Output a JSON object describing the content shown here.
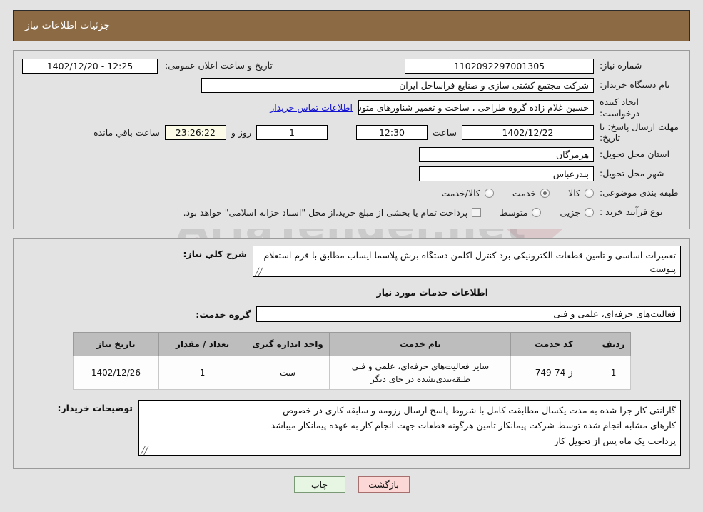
{
  "header": {
    "title": "جزئیات اطلاعات نیاز"
  },
  "form": {
    "need_number_label": "شماره نیاز:",
    "need_number_value": "1102092297001305",
    "announce_label": "تاریخ و ساعت اعلان عمومی:",
    "announce_value": "12:25 - 1402/12/20",
    "buyer_label": "نام دستگاه خریدار:",
    "buyer_value": "شرکت مجتمع کشتی سازی و صنایع فراساحل ایران",
    "creator_label": "ایجاد کننده درخواست:",
    "creator_value": "حسین  غلام زاده گروه طراحی ، ساخت و تعمیر شناورهای متوسط شرکت مجتد",
    "contact_link": "اطلاعات تماس خریدار",
    "deadline_label": "مهلت ارسال پاسخ: تا تاریخ:",
    "deadline_date": "1402/12/22",
    "hour_word": "ساعت",
    "deadline_time": "12:30",
    "days_value": "1",
    "days_word": "روز و",
    "timer_value": "23:26:22",
    "remaining_word": "ساعت باقي مانده",
    "province_label": "استان محل تحویل:",
    "province_value": "هرمزگان",
    "city_label": "شهر محل تحویل:",
    "city_value": "بندرعباس",
    "category_label": "طبقه بندی موضوعی:",
    "category_options": [
      {
        "label": "کالا",
        "selected": false
      },
      {
        "label": "خدمت",
        "selected": true
      },
      {
        "label": "کالا/خدمت",
        "selected": false
      }
    ],
    "process_label": "نوع فرآیند خرید :",
    "process_options": [
      {
        "label": "جزیی",
        "selected": false
      },
      {
        "label": "متوسط",
        "selected": false
      }
    ],
    "treasury_note": "پرداخت تمام یا بخشی از مبلغ خرید،از محل \"اسناد خزانه اسلامی\" خواهد بود."
  },
  "description": {
    "label": "شرح کلي نیاز:",
    "value": "تعمیرات اساسی و تامین قطعات الکترونیکی برد کنترل اکلمن دستگاه برش پلاسما ایساب مطابق با فرم استعلام پیوست"
  },
  "services": {
    "section_title": "اطلاعات خدمات مورد نیاز",
    "group_label": "گروه خدمت:",
    "group_value": "فعالیت‌های حرفه‌ای، علمی و فنی",
    "columns": [
      "ردیف",
      "کد خدمت",
      "نام خدمت",
      "واحد اندازه گیری",
      "تعداد / مقدار",
      "تاریخ نیاز"
    ],
    "rows": [
      {
        "radif": "1",
        "code": "ز-74-749",
        "name": "سایر فعالیت‌های حرفه‌ای، علمی و فنی طبقه‌بندی‌نشده در جای دیگر",
        "unit": "ست",
        "qty": "1",
        "date": "1402/12/26"
      }
    ]
  },
  "buyer_notes": {
    "label": "توضیحات خریدار:",
    "lines": [
      "گارانتی کار جرا شده به مدت یکسال        مطابقت کامل با شروط پاسخ         ارسال رزومه  و سابقه کاری در خصوص",
      "کارهای مشابه انجام شده توسط شرکت پیمانکار         تامین هرگونه قطعات  جهت انجام کار به عهده پیمانکار میباشد",
      "پرداخت یک ماه پس از تحویل کار"
    ]
  },
  "buttons": {
    "print": "چاپ",
    "back": "بازگشت"
  },
  "watermark": {
    "text": "AriaTender.net"
  },
  "colors": {
    "header_bg": "#8b6a44",
    "link": "#1414d2",
    "timer_bg": "#fbfbe8",
    "print_bg": "#e6f6e2",
    "back_bg": "#fbd8d6"
  }
}
